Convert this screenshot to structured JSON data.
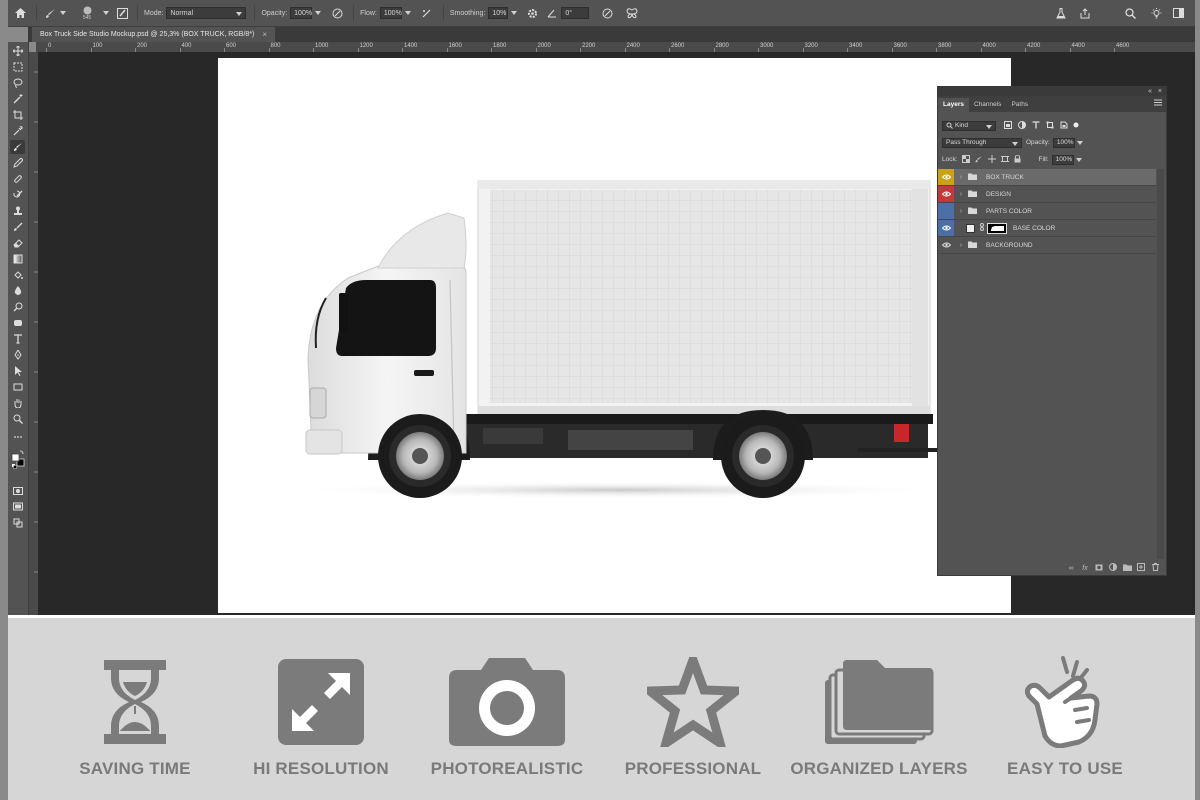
{
  "options_bar": {
    "brush_size": "545",
    "mode_label": "Mode:",
    "mode_value": "Normal",
    "opacity_label": "Opacity:",
    "opacity_value": "100%",
    "flow_label": "Flow:",
    "flow_value": "100%",
    "smoothing_label": "Smoothing:",
    "smoothing_value": "10%",
    "angle_value": "0°"
  },
  "document_tab": {
    "title": "Box Truck Side Studio Mockup.psd @ 25,3% (BOX TRUCK, RGB/8*)",
    "close": "×"
  },
  "ruler_ticks": [
    "0",
    "100",
    "200",
    "400",
    "600",
    "800",
    "1000",
    "1200",
    "1400",
    "1600",
    "1800",
    "2000",
    "2200",
    "2400",
    "2600",
    "2800",
    "3000",
    "3200",
    "3400",
    "3600",
    "3800",
    "4000",
    "4200",
    "4400",
    "4600"
  ],
  "layers_panel": {
    "tabs": [
      "Layers",
      "Channels",
      "Paths"
    ],
    "active_tab": "Layers",
    "filter_kind": "Kind",
    "blend_mode": "Pass Through",
    "opacity_label": "Opacity:",
    "opacity_value": "100%",
    "lock_label": "Lock:",
    "fill_label": "Fill:",
    "fill_value": "100%",
    "layers": [
      {
        "name": "BOX TRUCK",
        "type": "group",
        "color": "#c9a21a",
        "visible": true,
        "selected": true
      },
      {
        "name": "DESIGN",
        "type": "group",
        "color": "#c0393b",
        "visible": true,
        "selected": false
      },
      {
        "name": "PARTS COLOR",
        "type": "group",
        "color": "#4c6fa8",
        "visible": false,
        "selected": false
      },
      {
        "name": "BASE COLOR",
        "type": "layer",
        "color": "#4c6fa8",
        "visible": true,
        "selected": false
      },
      {
        "name": "BACKGROUND",
        "type": "group",
        "color": "",
        "visible": true,
        "selected": false
      }
    ]
  },
  "features": [
    {
      "label": "SAVING TIME",
      "icon": "hourglass-icon"
    },
    {
      "label": "HI RESOLUTION",
      "icon": "expand-arrows-icon"
    },
    {
      "label": "PHOTOREALISTIC",
      "icon": "camera-icon"
    },
    {
      "label": "PROFESSIONAL",
      "icon": "star-icon"
    },
    {
      "label": "ORGANIZED LAYERS",
      "icon": "folder-stack-icon"
    },
    {
      "label": "EASY TO USE",
      "icon": "pointing-hand-icon"
    }
  ],
  "colors": {
    "feature_icon": "#7b7b7b",
    "feature_label": "#7a7a7a",
    "feature_bg": "#d6d6d6",
    "ui_panel": "#535353",
    "ui_dark": "#282828"
  }
}
